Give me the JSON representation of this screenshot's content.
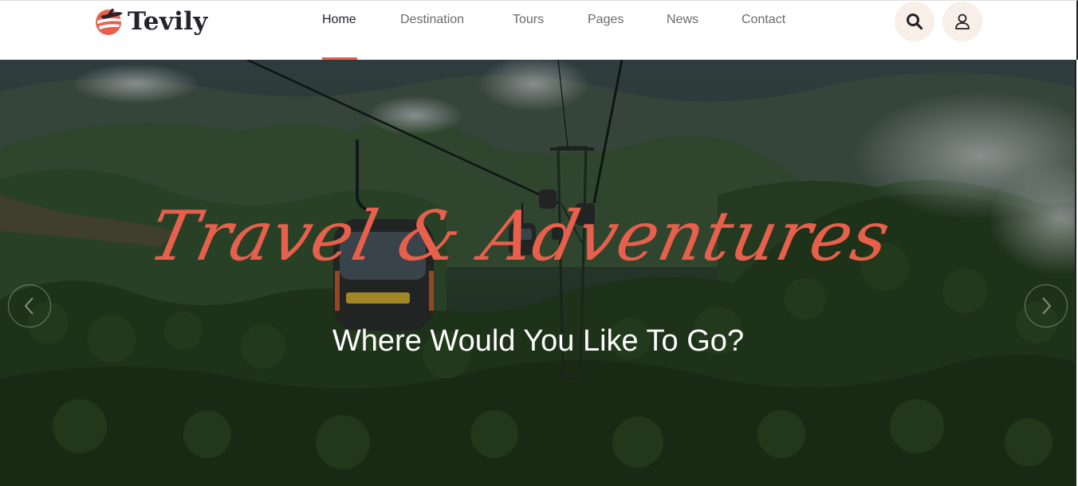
{
  "brand": {
    "name": "Tevily"
  },
  "nav": {
    "items": [
      {
        "label": "Home",
        "active": true
      },
      {
        "label": "Destination",
        "active": false
      },
      {
        "label": "Tours",
        "active": false
      },
      {
        "label": "Pages",
        "active": false
      },
      {
        "label": "News",
        "active": false
      },
      {
        "label": "Contact",
        "active": false
      }
    ]
  },
  "header_actions": {
    "search_icon": "search-icon",
    "account_icon": "user-icon"
  },
  "hero": {
    "script_title": "Travel & Adventures",
    "subtitle": "Where Would You Like To Go?",
    "prev_icon": "chevron-left-icon",
    "next_icon": "chevron-right-icon"
  },
  "colors": {
    "accent": "#e8604c",
    "dark": "#24232b",
    "nav_text": "#6b6b6b",
    "action_bg": "#f7efe8"
  }
}
